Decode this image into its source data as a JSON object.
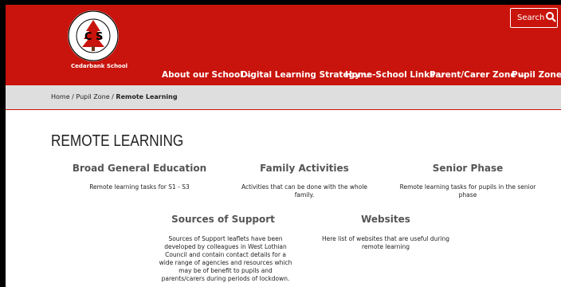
{
  "header": {
    "school_name": "Cedarbank School",
    "logo_letters": "C S",
    "search_label": "Search",
    "nav": [
      {
        "label": "About our School"
      },
      {
        "label": "Digital Learning Strategy"
      },
      {
        "label": "Home-School Links"
      },
      {
        "label": "Parent/Carer Zone"
      },
      {
        "label": "Pupil Zone"
      }
    ]
  },
  "breadcrumb": {
    "home": "Home",
    "sep1": "/",
    "parent": "Pupil Zone",
    "sep2": "/",
    "current": "Remote Learning"
  },
  "page_title": "REMOTE LEARNING",
  "cards": [
    {
      "title": "Broad General Education",
      "text": "Remote learning tasks for S1 - S3"
    },
    {
      "title": "Family Activities",
      "text": "Activities that can be done with the whole family."
    },
    {
      "title": "Senior Phase",
      "text": "Remote learning tasks for pupils in the senior phase"
    },
    {
      "title": "Sources of Support",
      "text": "Sources of Support leaflets have been developed by colleagues in West Lothian Council and contain contact details for a wide range of agencies and resources which may be of benefit to pupils and parents/carers during periods of lockdown."
    },
    {
      "title": "Websites",
      "text": "Here list of websites that are useful during remote learning"
    }
  ],
  "colors": {
    "brand_red": "#c8140c",
    "crumb_bg": "#dedede"
  }
}
